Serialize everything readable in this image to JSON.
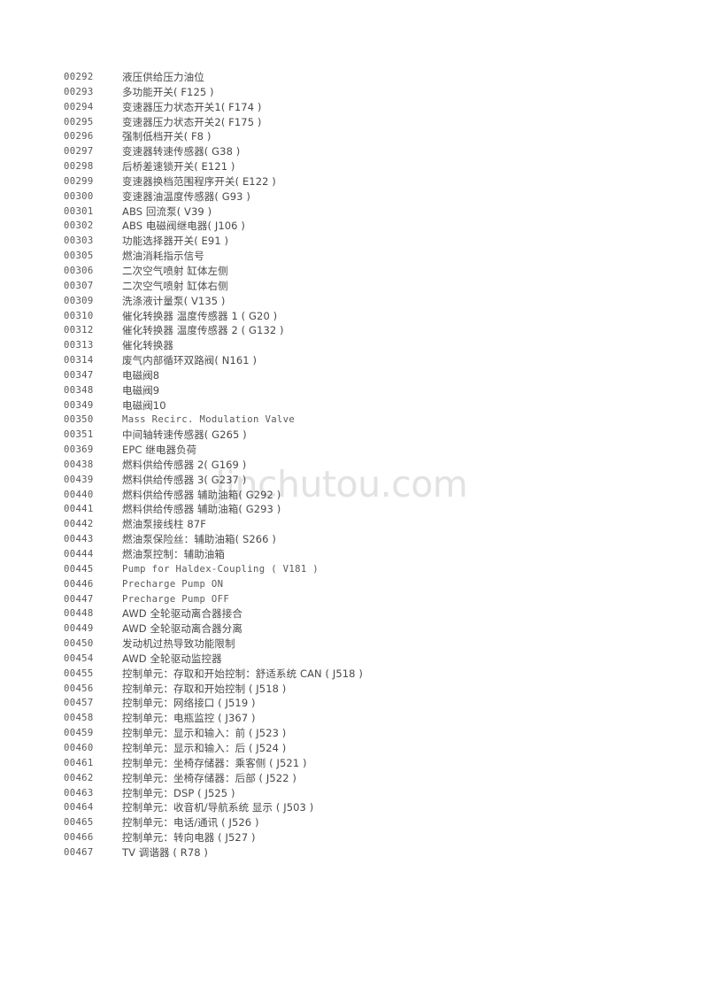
{
  "page": {
    "background_color": "#ffffff",
    "text_color": "#494949"
  },
  "watermark": {
    "text": "Jinchutou.com",
    "color": "#e2e2e2"
  },
  "code_list": {
    "columns": [
      "code",
      "description"
    ],
    "rows": [
      {
        "code": "00292",
        "description": "液压供给压力油位"
      },
      {
        "code": "00293",
        "description": "多功能开关( F125  )"
      },
      {
        "code": "00294",
        "description": "变速器压力状态开关1( F174  )"
      },
      {
        "code": "00295",
        "description": "变速器压力状态开关2( F175  )"
      },
      {
        "code": "00296",
        "description": "强制低档开关( F8  )"
      },
      {
        "code": "00297",
        "description": "变速器转速传感器( G38  )"
      },
      {
        "code": "00298",
        "description": "后桥差速锁开关( E121  )"
      },
      {
        "code": "00299",
        "description": "变速器换档范围程序开关( E122  )"
      },
      {
        "code": "00300",
        "description": "变速器油温度传感器( G93  )"
      },
      {
        "code": "00301",
        "description": "ABS 回流泵( V39  )"
      },
      {
        "code": "00302",
        "description": "ABS 电磁阀继电器( J106  )"
      },
      {
        "code": "00303",
        "description": "功能选择器开关( E91  )"
      },
      {
        "code": "00305",
        "description": "燃油消耗指示信号"
      },
      {
        "code": "00306",
        "description": "二次空气喷射 缸体左侧"
      },
      {
        "code": "00307",
        "description": "二次空气喷射 缸体右侧"
      },
      {
        "code": "00309",
        "description": "洗涤液计量泵( V135  )"
      },
      {
        "code": "00310",
        "description": "催化转换器 温度传感器 1 ( G20  )"
      },
      {
        "code": "00312",
        "description": "催化转换器 温度传感器 2 ( G132  )"
      },
      {
        "code": "00313",
        "description": "催化转换器"
      },
      {
        "code": "00314",
        "description": "废气内部循环双路阀( N161  )"
      },
      {
        "code": "00347",
        "description": "电磁阀8"
      },
      {
        "code": "00348",
        "description": "电磁阀9"
      },
      {
        "code": "00349",
        "description": "电磁阀10"
      },
      {
        "code": "00350",
        "description": "Mass Recirc. Modulation Valve",
        "latin": true
      },
      {
        "code": "00351",
        "description": "中间轴转速传感器( G265  )"
      },
      {
        "code": "00369",
        "description": "EPC 继电器负荷"
      },
      {
        "code": "00438",
        "description": "燃料供给传感器 2( G169  )"
      },
      {
        "code": "00439",
        "description": "燃料供给传感器 3( G237  )"
      },
      {
        "code": "00440",
        "description": "燃料供给传感器 辅助油箱( G292  )"
      },
      {
        "code": "00441",
        "description": "燃料供给传感器 辅助油箱( G293  )"
      },
      {
        "code": "00442",
        "description": "燃油泵接线柱 87F"
      },
      {
        "code": "00443",
        "description": "燃油泵保险丝：辅助油箱( S266  )"
      },
      {
        "code": "00444",
        "description": "燃油泵控制：辅助油箱"
      },
      {
        "code": "00445",
        "description": "Pump for Haldex-Coupling ( V181 )",
        "latin": true
      },
      {
        "code": "00446",
        "description": "Precharge Pump ON",
        "latin": true
      },
      {
        "code": "00447",
        "description": "Precharge Pump OFF",
        "latin": true
      },
      {
        "code": "00448",
        "description": "AWD 全轮驱动离合器接合"
      },
      {
        "code": "00449",
        "description": "AWD 全轮驱动离合器分离"
      },
      {
        "code": "00450",
        "description": "发动机过热导致功能限制"
      },
      {
        "code": "00454",
        "description": "AWD 全轮驱动监控器"
      },
      {
        "code": "00455",
        "description": "控制单元：存取和开始控制：舒适系统 CAN ( J518  )"
      },
      {
        "code": "00456",
        "description": "控制单元：存取和开始控制 ( J518  )"
      },
      {
        "code": "00457",
        "description": "控制单元：网络接口 ( J519  )"
      },
      {
        "code": "00458",
        "description": "控制单元：电瓶监控 ( J367  )"
      },
      {
        "code": "00459",
        "description": "控制单元：显示和输入：前 ( J523  )"
      },
      {
        "code": "00460",
        "description": "控制单元：显示和输入：后 ( J524  )"
      },
      {
        "code": "00461",
        "description": "控制单元：坐椅存储器：乘客侧 ( J521  )"
      },
      {
        "code": "00462",
        "description": "控制单元：坐椅存储器：后部 ( J522  )"
      },
      {
        "code": "00463",
        "description": "控制单元：DSP ( J525  )"
      },
      {
        "code": "00464",
        "description": "控制单元：收音机/导航系统 显示 ( J503  )"
      },
      {
        "code": "00465",
        "description": "控制单元：电话/通讯 ( J526  )"
      },
      {
        "code": "00466",
        "description": "控制单元：转向电器 ( J527  )"
      },
      {
        "code": "00467",
        "description": "TV 调谐器 ( R78  )"
      }
    ]
  }
}
